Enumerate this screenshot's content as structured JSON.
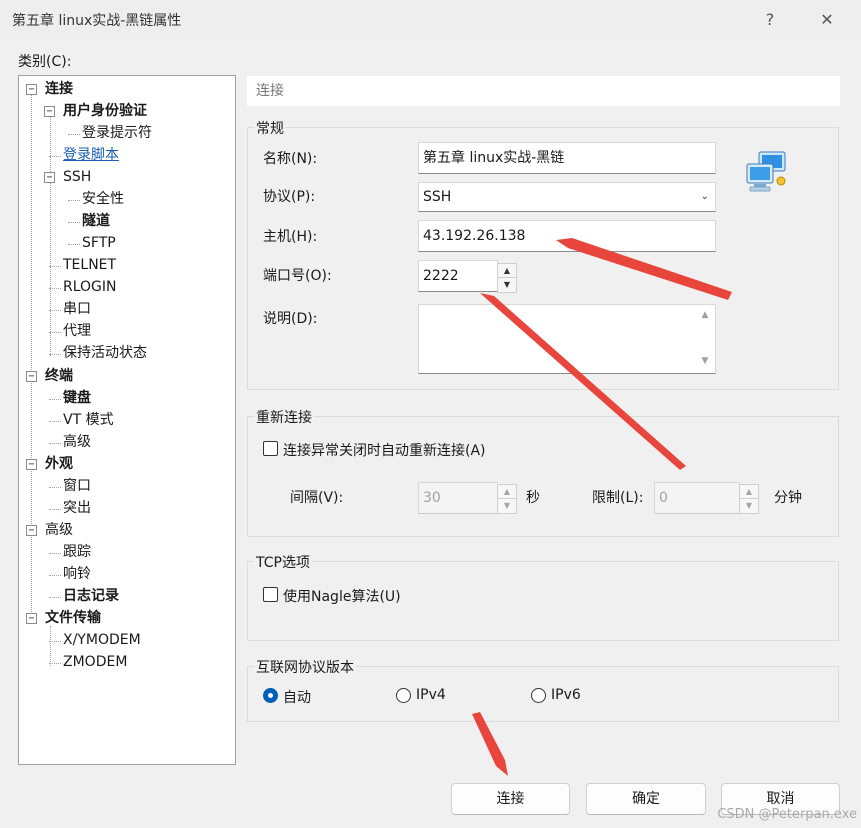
{
  "window": {
    "title": "第五章 linux实战-黑链属性",
    "help_glyph": "?",
    "close_glyph": "✕"
  },
  "category_label": "类别(C):",
  "tree": {
    "items": [
      {
        "label": "连接",
        "bold": true,
        "level": 0,
        "expander": "−"
      },
      {
        "label": "用户身份验证",
        "bold": true,
        "level": 1,
        "expander": "−"
      },
      {
        "label": "登录提示符",
        "level": 2
      },
      {
        "label": "登录脚本",
        "level": 1,
        "link": true
      },
      {
        "label": "SSH",
        "level": 1,
        "expander": "−"
      },
      {
        "label": "安全性",
        "level": 2
      },
      {
        "label": "隧道",
        "bold": true,
        "level": 2
      },
      {
        "label": "SFTP",
        "level": 2
      },
      {
        "label": "TELNET",
        "level": 1
      },
      {
        "label": "RLOGIN",
        "level": 1
      },
      {
        "label": "串口",
        "level": 1
      },
      {
        "label": "代理",
        "level": 1
      },
      {
        "label": "保持活动状态",
        "level": 1
      },
      {
        "label": "终端",
        "bold": true,
        "level": 0,
        "expander": "−"
      },
      {
        "label": "键盘",
        "bold": true,
        "level": 1
      },
      {
        "label": "VT 模式",
        "level": 1
      },
      {
        "label": "高级",
        "level": 1
      },
      {
        "label": "外观",
        "bold": true,
        "level": 0,
        "expander": "−"
      },
      {
        "label": "窗口",
        "level": 1
      },
      {
        "label": "突出",
        "level": 1
      },
      {
        "label": "高级",
        "level": 0,
        "expander": "−"
      },
      {
        "label": "跟踪",
        "level": 1
      },
      {
        "label": "响铃",
        "level": 1
      },
      {
        "label": "日志记录",
        "bold": true,
        "level": 1
      },
      {
        "label": "文件传输",
        "bold": true,
        "level": 0,
        "expander": "−"
      },
      {
        "label": "X/YMODEM",
        "level": 1
      },
      {
        "label": "ZMODEM",
        "level": 1
      }
    ]
  },
  "header_strip": "连接",
  "general": {
    "title": "常规",
    "name_label": "名称(N):",
    "name_value": "第五章 linux实战-黑链",
    "protocol_label": "协议(P):",
    "protocol_value": "SSH",
    "host_label": "主机(H):",
    "host_value": "43.192.26.138",
    "port_label": "端口号(O):",
    "port_value": "2222",
    "desc_label": "说明(D):",
    "desc_value": ""
  },
  "reconnect": {
    "title": "重新连接",
    "checkbox_label": "连接异常关闭时自动重新连接(A)",
    "checked": false,
    "interval_label": "间隔(V):",
    "interval_value": "30",
    "interval_unit": "秒",
    "limit_label": "限制(L):",
    "limit_value": "0",
    "limit_unit": "分钟"
  },
  "tcp": {
    "title": "TCP选项",
    "nagle_label": "使用Nagle算法(U)",
    "checked": false
  },
  "ip_version": {
    "title": "互联网协议版本",
    "options": [
      "自动",
      "IPv4",
      "IPv6"
    ],
    "selected": "自动"
  },
  "buttons": {
    "connect": "连接",
    "ok": "确定",
    "cancel": "取消"
  },
  "watermark": "CSDN @Peterpan.exe",
  "colors": {
    "arrow": "#e8453c",
    "accent": "#005fb8",
    "link": "#1a5fb4"
  }
}
